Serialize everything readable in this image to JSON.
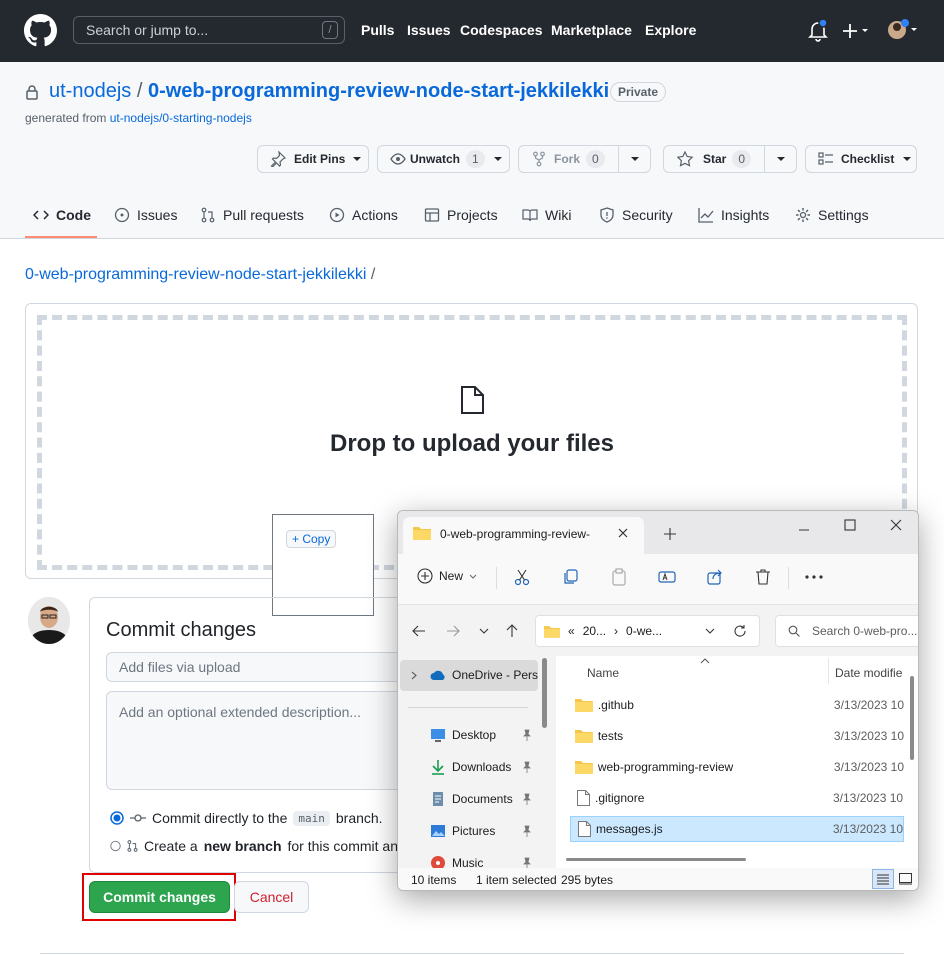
{
  "header": {
    "search_placeholder": "Search or jump to...",
    "search_shortcut": "/",
    "nav": [
      "Pulls",
      "Issues",
      "Codespaces",
      "Marketplace",
      "Explore"
    ],
    "notification_color": "#2f81f7"
  },
  "repo": {
    "owner": "ut-nodejs",
    "separator": "/",
    "name": "0-web-programming-review-node-start-jekkilekki",
    "visibility": "Private",
    "generated_prefix": "generated from",
    "generated_link": "ut-nodejs/0-starting-nodejs"
  },
  "actions": {
    "edit_pins": "Edit Pins",
    "unwatch": "Unwatch",
    "unwatch_count": "1",
    "fork": "Fork",
    "fork_count": "0",
    "star": "Star",
    "star_count": "0",
    "checklist": "Checklist"
  },
  "tabs": {
    "code": "Code",
    "issues": "Issues",
    "pull_requests": "Pull requests",
    "actions": "Actions",
    "projects": "Projects",
    "wiki": "Wiki",
    "security": "Security",
    "insights": "Insights",
    "settings": "Settings"
  },
  "upload": {
    "breadcrumb_repo": "0-web-programming-review-node-start-jekkilekki",
    "breadcrumb_sep": "/",
    "drop_text": "Drop to upload your files",
    "copy_label": "+ Copy"
  },
  "commit": {
    "title": "Commit changes",
    "summary_placeholder": "Add files via upload",
    "description_placeholder": "Add an optional extended description...",
    "option1_prefix": "Commit directly to the",
    "option1_branch": "main",
    "option1_suffix": "branch.",
    "option2_prefix": "Create a",
    "option2_bold": "new branch",
    "option2_suffix": "for this commit an",
    "commit_button": "Commit changes",
    "cancel_button": "Cancel",
    "primary_color": "#2da44e",
    "highlight_color": "#e00000",
    "cancel_color": "#cf222e"
  },
  "explorer": {
    "tab_title": "0-web-programming-review-",
    "new_label": "New",
    "address_parts": [
      "«",
      "20...",
      "›",
      "0-we..."
    ],
    "search_placeholder": "Search 0-web-pro...",
    "col_name": "Name",
    "col_date": "Date modifie",
    "nav_top": "OneDrive - Pers",
    "nav_items": [
      {
        "label": "Desktop",
        "icon": "desktop-icon"
      },
      {
        "label": "Downloads",
        "icon": "downloads-icon"
      },
      {
        "label": "Documents",
        "icon": "documents-icon"
      },
      {
        "label": "Pictures",
        "icon": "pictures-icon"
      },
      {
        "label": "Music",
        "icon": "music-icon"
      }
    ],
    "files": [
      {
        "name": ".github",
        "date": "3/13/2023 10",
        "type": "folder"
      },
      {
        "name": "tests",
        "date": "3/13/2023 10",
        "type": "folder"
      },
      {
        "name": "web-programming-review",
        "date": "3/13/2023 10",
        "type": "folder"
      },
      {
        "name": ".gitignore",
        "date": "3/13/2023 10",
        "type": "file"
      },
      {
        "name": "messages.js",
        "date": "3/13/2023 10",
        "type": "file",
        "selected": true
      }
    ],
    "status_items": "10 items",
    "status_selected": "1 item selected",
    "status_size": "295 bytes"
  }
}
